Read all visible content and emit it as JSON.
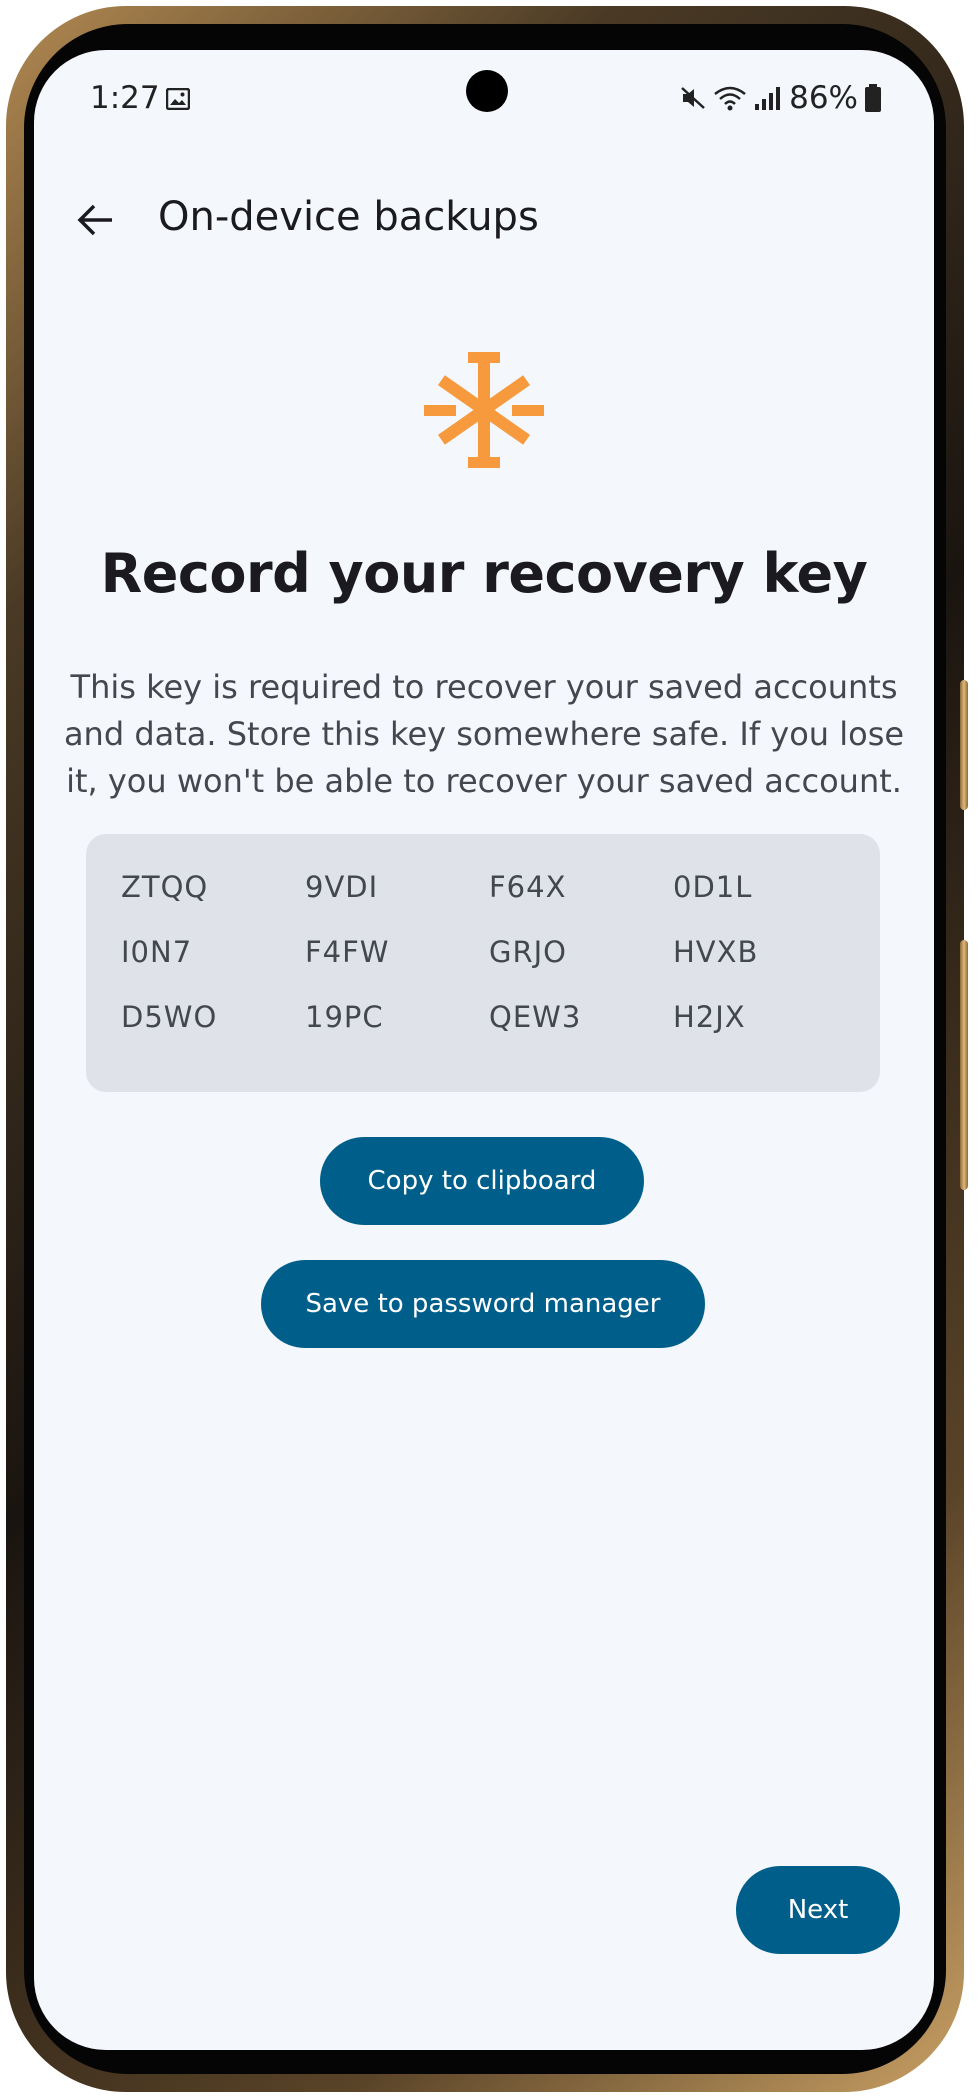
{
  "status_bar": {
    "time": "1:27",
    "battery": "86%",
    "icons": [
      "gallery-icon",
      "mute-icon",
      "wifi-icon",
      "signal-icon",
      "battery-icon"
    ]
  },
  "app_bar": {
    "title": "On-device backups",
    "back_icon": "arrow-left-icon"
  },
  "hero": {
    "icon": "asterisk-key-icon",
    "icon_color": "#f79a3e",
    "headline": "Record your recovery key",
    "description": "This key is required to recover your saved accounts and data. Store this key somewhere safe. If you lose it, you won't be able to recover your saved account."
  },
  "recovery_key": {
    "rows": [
      [
        "ZTQQ",
        "9VDI",
        "F64X",
        "0D1L"
      ],
      [
        "I0N7",
        "F4FW",
        "GRJO",
        "HVXB"
      ],
      [
        "D5WO",
        "19PC",
        "QEW3",
        "H2JX"
      ]
    ]
  },
  "actions": {
    "copy_label": "Copy to clipboard",
    "save_label": "Save to password manager",
    "next_label": "Next"
  },
  "colors": {
    "primary": "#005f8a",
    "background": "#f4f7fc",
    "key_box": "#dfe3e9",
    "accent": "#f79a3e"
  }
}
